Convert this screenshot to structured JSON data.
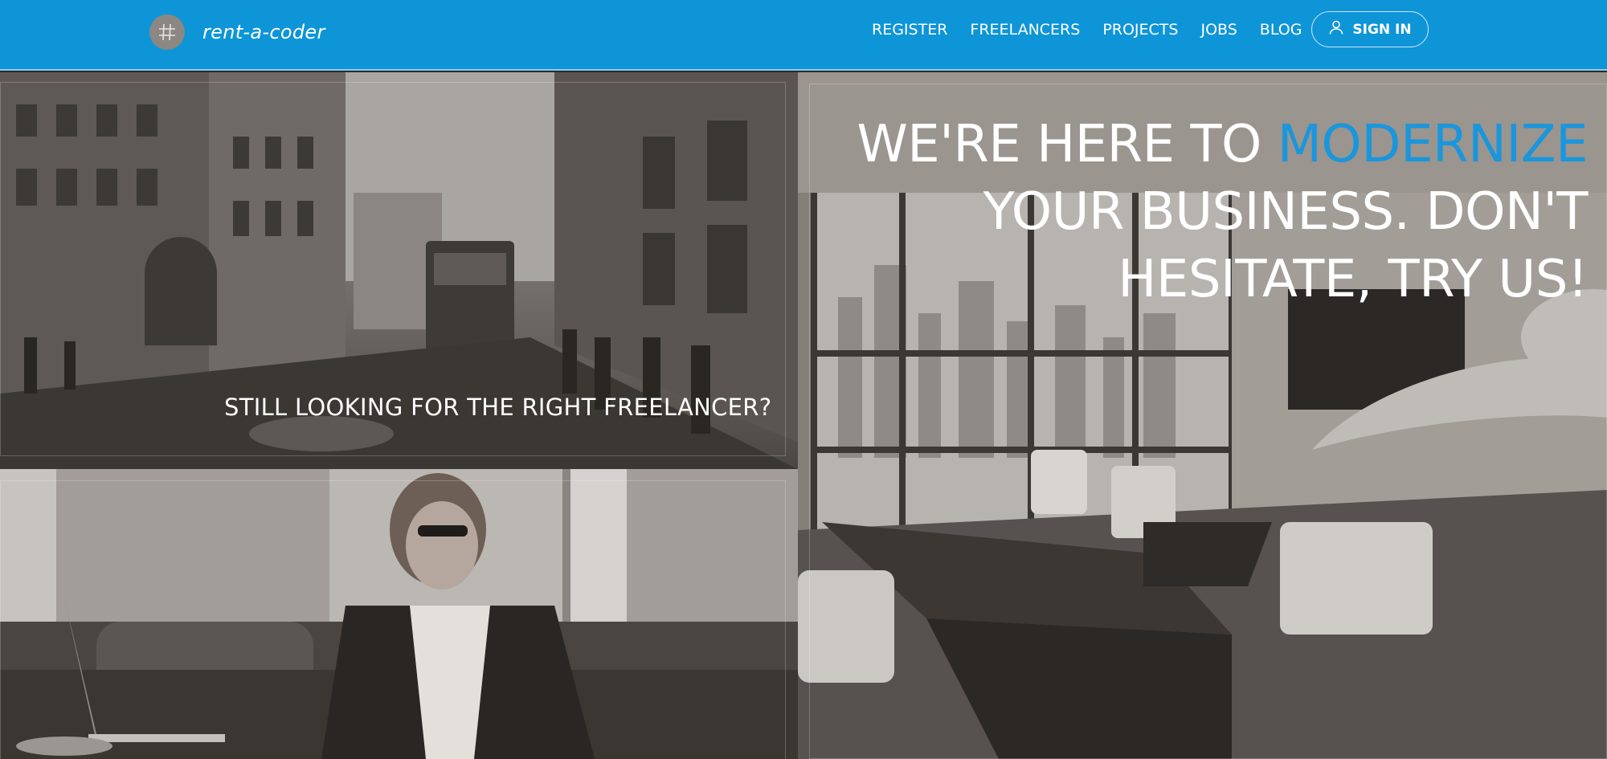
{
  "brand": {
    "name": "rent-a-coder",
    "logo_icon": "hash-grid-icon"
  },
  "nav": {
    "items": [
      "REGISTER",
      "FREELANCERS",
      "PROJECTS",
      "JOBS",
      "BLOG"
    ],
    "signin_label": "SIGN IN",
    "signin_icon": "user-icon"
  },
  "panels": {
    "street": {
      "caption": "STILL LOOKING FOR THE RIGHT FREELANCER?"
    },
    "office": {
      "hero": {
        "line1_prefix": "WE'RE HERE TO ",
        "line1_accent": "MODERNIZE",
        "line2": "YOUR BUSINESS. DON'T",
        "line3": "HESITATE, TRY US!"
      }
    }
  },
  "colors": {
    "header_bg": "#0e95d8",
    "accent": "#1a96dc",
    "text": "#ffffff"
  }
}
